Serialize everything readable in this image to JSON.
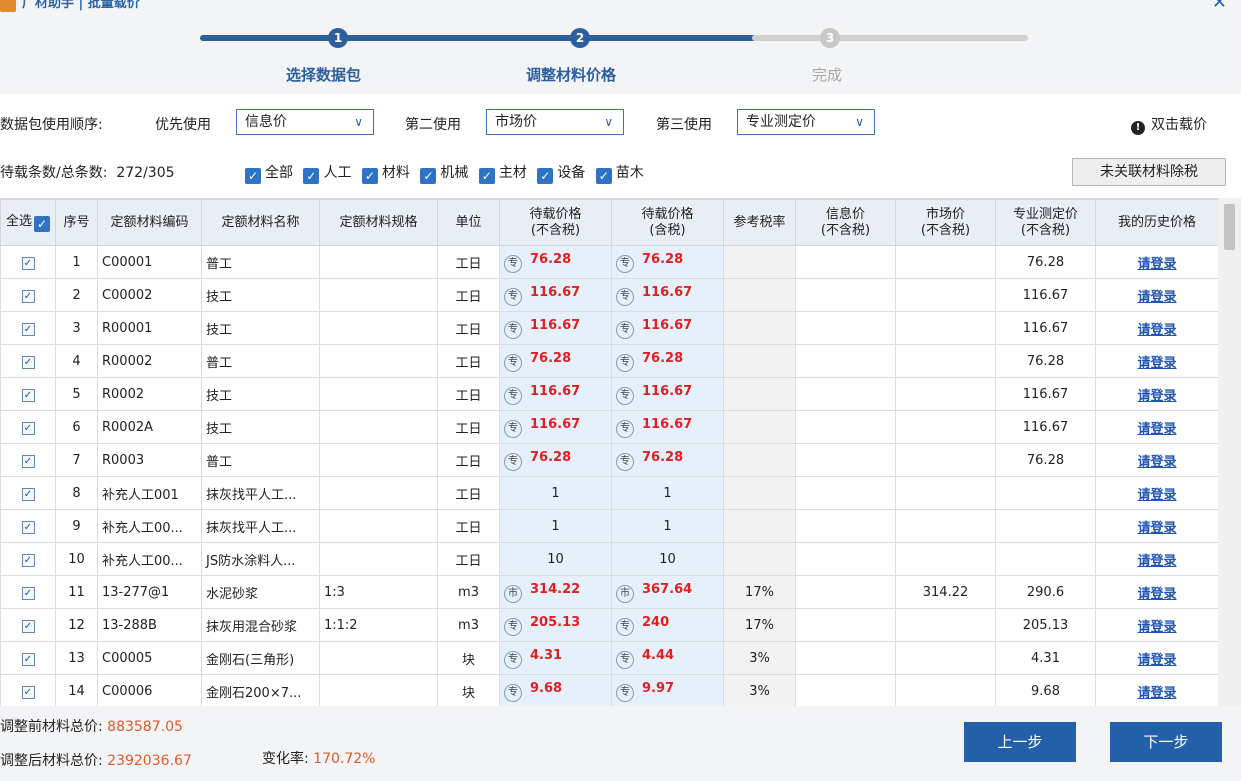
{
  "window": {
    "title": "广材助手 | 批量载价",
    "close_glyph": "✕"
  },
  "stepper": {
    "steps": [
      {
        "num": "1",
        "label": "选择数据包"
      },
      {
        "num": "2",
        "label": "调整材料价格"
      },
      {
        "num": "3",
        "label": "完成"
      }
    ]
  },
  "order": {
    "label": "数据包使用顺序:",
    "first_label": "优先使用",
    "first_value": "信息价",
    "second_label": "第二使用",
    "second_value": "市场价",
    "third_label": "第三使用",
    "third_value": "专业测定价",
    "hint": "双击载价"
  },
  "filter": {
    "count_label": "待载条数/总条数:",
    "count_value": "272/305",
    "checkboxes": [
      "全部",
      "人工",
      "材料",
      "机械",
      "主材",
      "设备",
      "苗木"
    ],
    "tax_button": "未关联材料除税"
  },
  "table": {
    "headers": {
      "select_all": "全选",
      "index": "序号",
      "code": "定额材料编码",
      "name": "定额材料名称",
      "spec": "定额材料规格",
      "unit": "单位",
      "price_ex": [
        "待载价格",
        "(不含税)"
      ],
      "price_in": [
        "待载价格",
        "(含税)"
      ],
      "tax_rate": "参考税率",
      "info_price": [
        "信息价",
        "(不含税)"
      ],
      "market_price": [
        "市场价",
        "(不含税)"
      ],
      "pro_price": [
        "专业测定价",
        "(不含税)"
      ],
      "history": "我的历史价格"
    },
    "rows": [
      {
        "idx": "1",
        "code": "C00001",
        "name": "普工",
        "spec": "",
        "unit": "工日",
        "tag": "专",
        "ex": "76.28",
        "in": "76.28",
        "tax": "",
        "info": "",
        "market": "",
        "pro": "76.28",
        "history": "请登录"
      },
      {
        "idx": "2",
        "code": "C00002",
        "name": "技工",
        "spec": "",
        "unit": "工日",
        "tag": "专",
        "ex": "116.67",
        "in": "116.67",
        "tax": "",
        "info": "",
        "market": "",
        "pro": "116.67",
        "history": "请登录"
      },
      {
        "idx": "3",
        "code": "R00001",
        "name": "技工",
        "spec": "",
        "unit": "工日",
        "tag": "专",
        "ex": "116.67",
        "in": "116.67",
        "tax": "",
        "info": "",
        "market": "",
        "pro": "116.67",
        "history": "请登录"
      },
      {
        "idx": "4",
        "code": "R00002",
        "name": "普工",
        "spec": "",
        "unit": "工日",
        "tag": "专",
        "ex": "76.28",
        "in": "76.28",
        "tax": "",
        "info": "",
        "market": "",
        "pro": "76.28",
        "history": "请登录"
      },
      {
        "idx": "5",
        "code": "R0002",
        "name": "技工",
        "spec": "",
        "unit": "工日",
        "tag": "专",
        "ex": "116.67",
        "in": "116.67",
        "tax": "",
        "info": "",
        "market": "",
        "pro": "116.67",
        "history": "请登录"
      },
      {
        "idx": "6",
        "code": "R0002A",
        "name": "技工",
        "spec": "",
        "unit": "工日",
        "tag": "专",
        "ex": "116.67",
        "in": "116.67",
        "tax": "",
        "info": "",
        "market": "",
        "pro": "116.67",
        "history": "请登录"
      },
      {
        "idx": "7",
        "code": "R0003",
        "name": "普工",
        "spec": "",
        "unit": "工日",
        "tag": "专",
        "ex": "76.28",
        "in": "76.28",
        "tax": "",
        "info": "",
        "market": "",
        "pro": "76.28",
        "history": "请登录"
      },
      {
        "idx": "8",
        "code": "补充人工001",
        "name": "抹灰找平人工...",
        "spec": "",
        "unit": "工日",
        "tag": "",
        "ex": "1",
        "in": "1",
        "tax": "",
        "info": "",
        "market": "",
        "pro": "",
        "history": "请登录"
      },
      {
        "idx": "9",
        "code": "补充人工00...",
        "name": "抹灰找平人工...",
        "spec": "",
        "unit": "工日",
        "tag": "",
        "ex": "1",
        "in": "1",
        "tax": "",
        "info": "",
        "market": "",
        "pro": "",
        "history": "请登录"
      },
      {
        "idx": "10",
        "code": "补充人工00...",
        "name": "JS防水涂料人...",
        "spec": "",
        "unit": "工日",
        "tag": "",
        "ex": "10",
        "in": "10",
        "tax": "",
        "info": "",
        "market": "",
        "pro": "",
        "history": "请登录"
      },
      {
        "idx": "11",
        "code": "13-277@1",
        "name": "水泥砂浆",
        "spec": "1:3",
        "unit": "m3",
        "tag": "市",
        "ex": "314.22",
        "in": "367.64",
        "tax": "17%",
        "info": "",
        "market": "314.22",
        "pro": "290.6",
        "history": "请登录"
      },
      {
        "idx": "12",
        "code": "13-288B",
        "name": "抹灰用混合砂浆",
        "spec": "1:1:2",
        "unit": "m3",
        "tag": "专",
        "ex": "205.13",
        "in": "240",
        "tax": "17%",
        "info": "",
        "market": "",
        "pro": "205.13",
        "history": "请登录"
      },
      {
        "idx": "13",
        "code": "C00005",
        "name": "金刚石(三角形)",
        "spec": "",
        "unit": "块",
        "tag": "专",
        "ex": "4.31",
        "in": "4.44",
        "tax": "3%",
        "info": "",
        "market": "",
        "pro": "4.31",
        "history": "请登录"
      },
      {
        "idx": "14",
        "code": "C00006",
        "name": "金刚石200×7...",
        "spec": "",
        "unit": "块",
        "tag": "专",
        "ex": "9.68",
        "in": "9.97",
        "tax": "3%",
        "info": "",
        "market": "",
        "pro": "9.68",
        "history": "请登录"
      }
    ]
  },
  "footer": {
    "before_label": "调整前材料总价:",
    "before_value": "883587.05",
    "after_label": "调整后材料总价:",
    "after_value": "2392036.67",
    "rate_label": "变化率:",
    "rate_value": "170.72%",
    "prev": "上一步",
    "next": "下一步"
  },
  "colors": {
    "accent": "#2460aa",
    "price_red": "#e02020",
    "sum_orange": "#e05a2a"
  }
}
